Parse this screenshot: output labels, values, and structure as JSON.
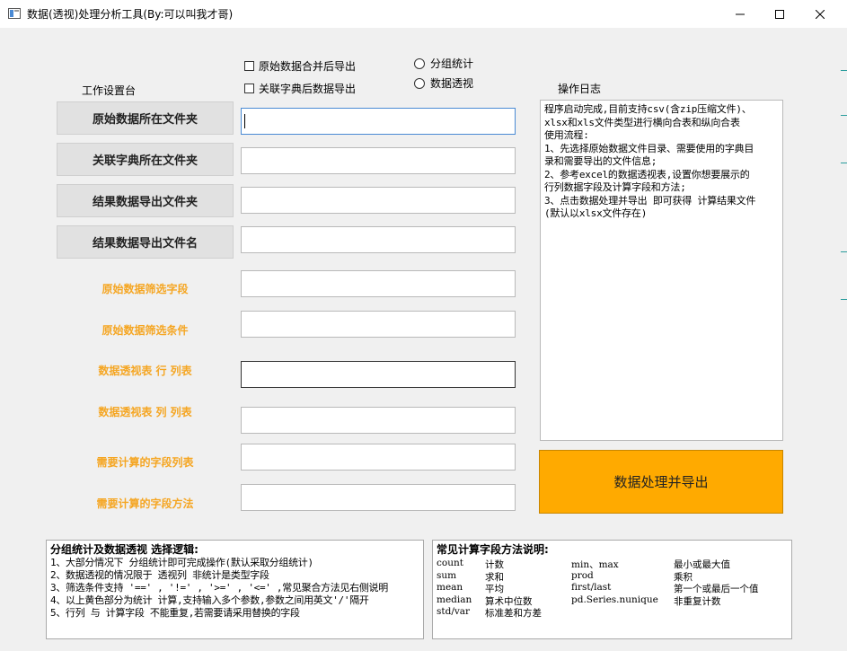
{
  "window": {
    "title": "数据(透视)处理分析工具(By:可以叫我才哥)"
  },
  "options": {
    "merge_export": "原始数据合并后导出",
    "dict_export": "关联字典后数据导出",
    "group_stats": "分组统计",
    "pivot": "数据透视"
  },
  "workbench": {
    "title": "工作设置台",
    "buttons": [
      "原始数据所在文件夹",
      "关联字典所在文件夹",
      "结果数据导出文件夹",
      "结果数据导出文件名"
    ],
    "fields": [
      "原始数据筛选字段",
      "原始数据筛选条件",
      "数据透视表 行 列表",
      "数据透视表 列 列表",
      "需要计算的字段列表",
      "需要计算的字段方法"
    ]
  },
  "log": {
    "title": "操作日志",
    "lines": [
      "程序启动完成,目前支持csv(含zip压缩文件)、",
      "xlsx和xls文件类型进行横向合表和纵向合表",
      "使用流程:",
      "1、先选择原始数据文件目录、需要使用的字典目",
      "录和需要导出的文件信息;",
      "2、参考excel的数据透视表,设置你想要展示的",
      "行列数据字段及计算字段和方法;",
      "3、点击数据处理并导出 即可获得 计算结果文件",
      "(默认以xlsx文件存在)"
    ]
  },
  "action": {
    "process_export": "数据处理并导出"
  },
  "notes_logic": {
    "title": "分组统计及数据透视 选择逻辑:",
    "lines": [
      "1、大部分情况下 分组统计即可完成操作(默认采取分组统计)",
      "2、数据透视的情况限于 透视列 非统计是类型字段",
      "3、筛选条件支持 '==' , '!=' , '>=' , '<=' ,常见聚合方法见右侧说明",
      "4、以上黄色部分为统计 计算,支持输入多个参数,参数之间用英文'/'隔开",
      "5、行列 与 计算字段 不能重复,若需要请采用替换的字段"
    ]
  },
  "notes_methods": {
    "title": "常见计算字段方法说明:",
    "rows": [
      [
        "count",
        "计数",
        "min、max",
        "最小或最大值"
      ],
      [
        "sum",
        "求和",
        "prod",
        "乘积"
      ],
      [
        "mean",
        "平均",
        "first/last",
        "第一个或最后一个值"
      ],
      [
        "median",
        "算术中位数",
        "pd.Series.nunique",
        "非重复计数"
      ],
      [
        "std/var",
        "标准差和方差",
        "",
        ""
      ]
    ]
  }
}
